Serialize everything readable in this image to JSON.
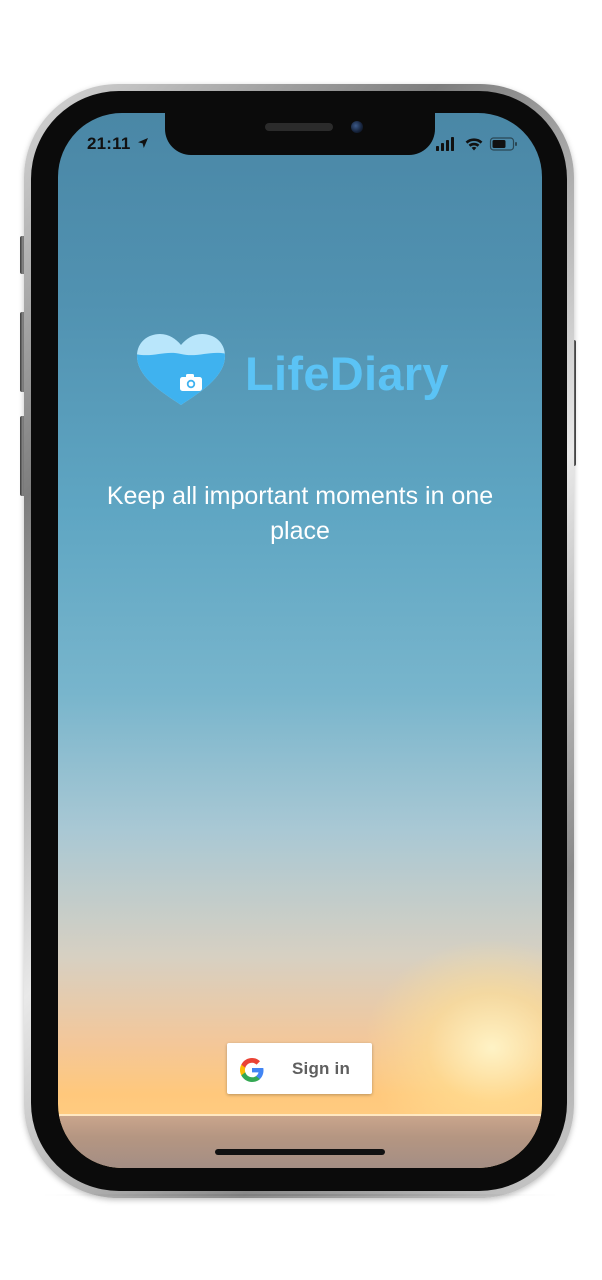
{
  "status_bar": {
    "time": "21:11",
    "icons": [
      "location-arrow-icon",
      "cellular-signal-icon",
      "wifi-icon",
      "battery-icon"
    ]
  },
  "app": {
    "name": "LifeDiary",
    "tagline": "Keep all important moments in one place",
    "logo_icon": "heart-camera-logo-icon",
    "brand_color": "#5bc3f5"
  },
  "signin": {
    "label": "Sign in",
    "icon": "google-g-icon"
  }
}
